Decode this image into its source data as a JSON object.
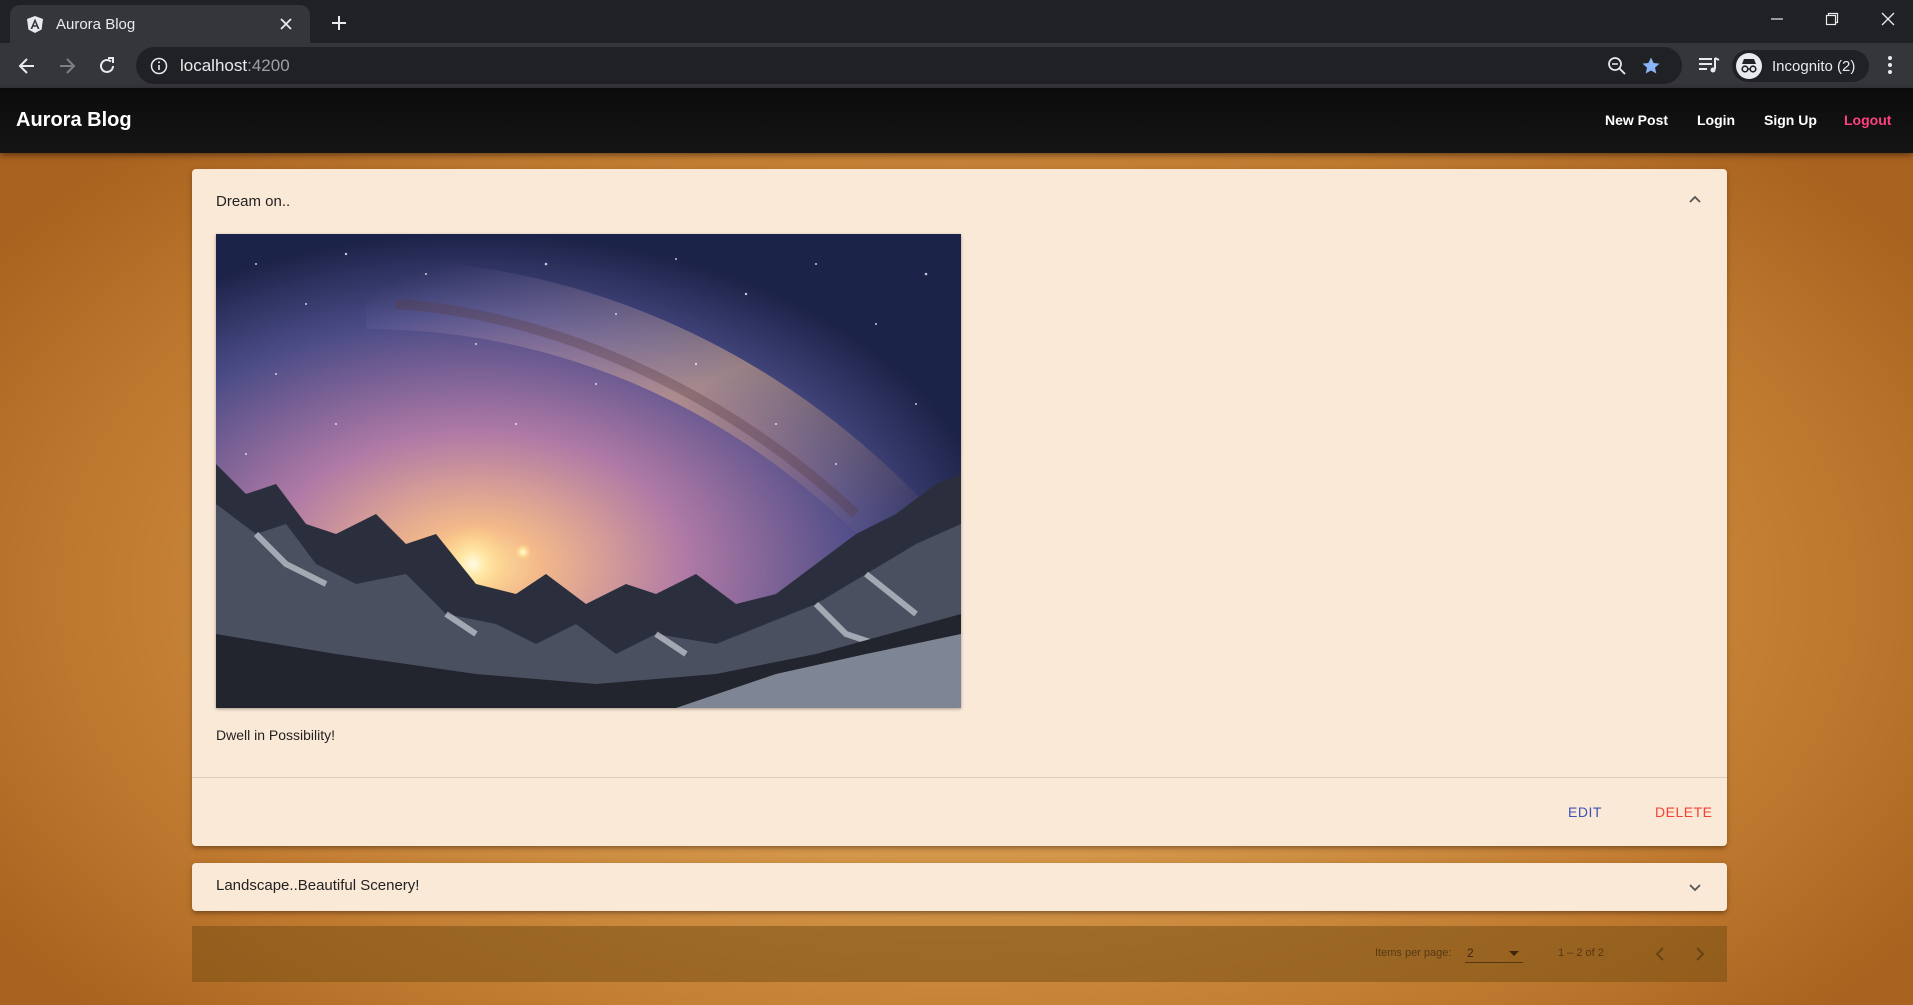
{
  "browser": {
    "tab_title": "Aurora Blog",
    "url_host": "localhost",
    "url_port": ":4200",
    "profile_label": "Incognito (2)",
    "icons": [
      "angular-favicon",
      "close-icon",
      "plus-icon",
      "minimize-icon",
      "restore-icon",
      "window-close-icon",
      "back-arrow-icon",
      "forward-arrow-icon",
      "reload-icon",
      "info-icon",
      "zoom-icon",
      "star-icon",
      "media-control-icon",
      "incognito-icon",
      "more-vert-icon"
    ]
  },
  "app": {
    "brand": "Aurora Blog",
    "nav": {
      "new_post": "New Post",
      "login": "Login",
      "signup": "Sign Up",
      "logout": "Logout"
    },
    "accent_colors": {
      "logout": "#ff4081",
      "edit": "#3f51b5",
      "delete": "#f44336"
    }
  },
  "posts": [
    {
      "title": "Dream on..",
      "expanded": true,
      "image_alt": "Milky way over snowy mountains",
      "content": "Dwell in Possibility!",
      "actions": {
        "edit": "EDIT",
        "delete": "DELETE"
      }
    },
    {
      "title": "Landscape..Beautiful Scenery!",
      "expanded": false
    }
  ],
  "paginator": {
    "items_per_page_label": "Items per page:",
    "items_per_page_value": "2",
    "range_label": "1 – 2 of 2"
  }
}
